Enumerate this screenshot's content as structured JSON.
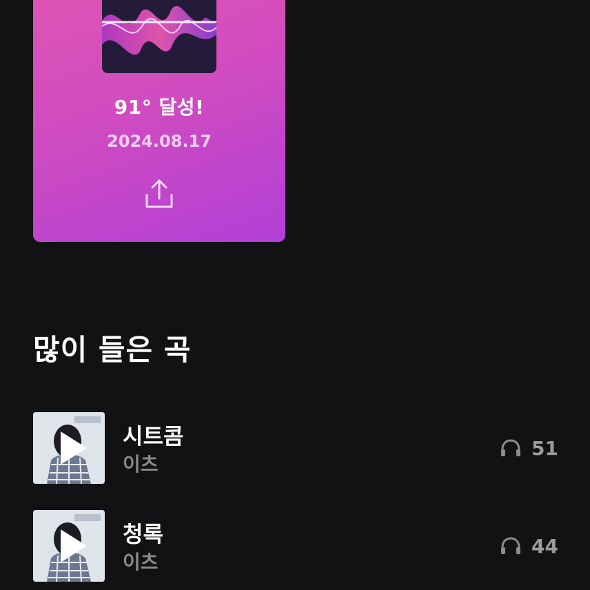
{
  "achievement": {
    "degree_text": "91° 달성!",
    "date": "2024.08.17",
    "share_icon": "share-upload-icon"
  },
  "colors": {
    "background": "#121113",
    "card_gradient_start": "#e054b4",
    "card_gradient_end": "#b13fd7",
    "muted_text": "#8a898c"
  },
  "section": {
    "title": "많이 들은 곡"
  },
  "songs": [
    {
      "title": "시트콤",
      "artist": "이츠",
      "plays": "51",
      "play_icon": "play-icon",
      "count_icon": "headphones-icon"
    },
    {
      "title": "청록",
      "artist": "이츠",
      "plays": "44",
      "play_icon": "play-icon",
      "count_icon": "headphones-icon"
    }
  ]
}
